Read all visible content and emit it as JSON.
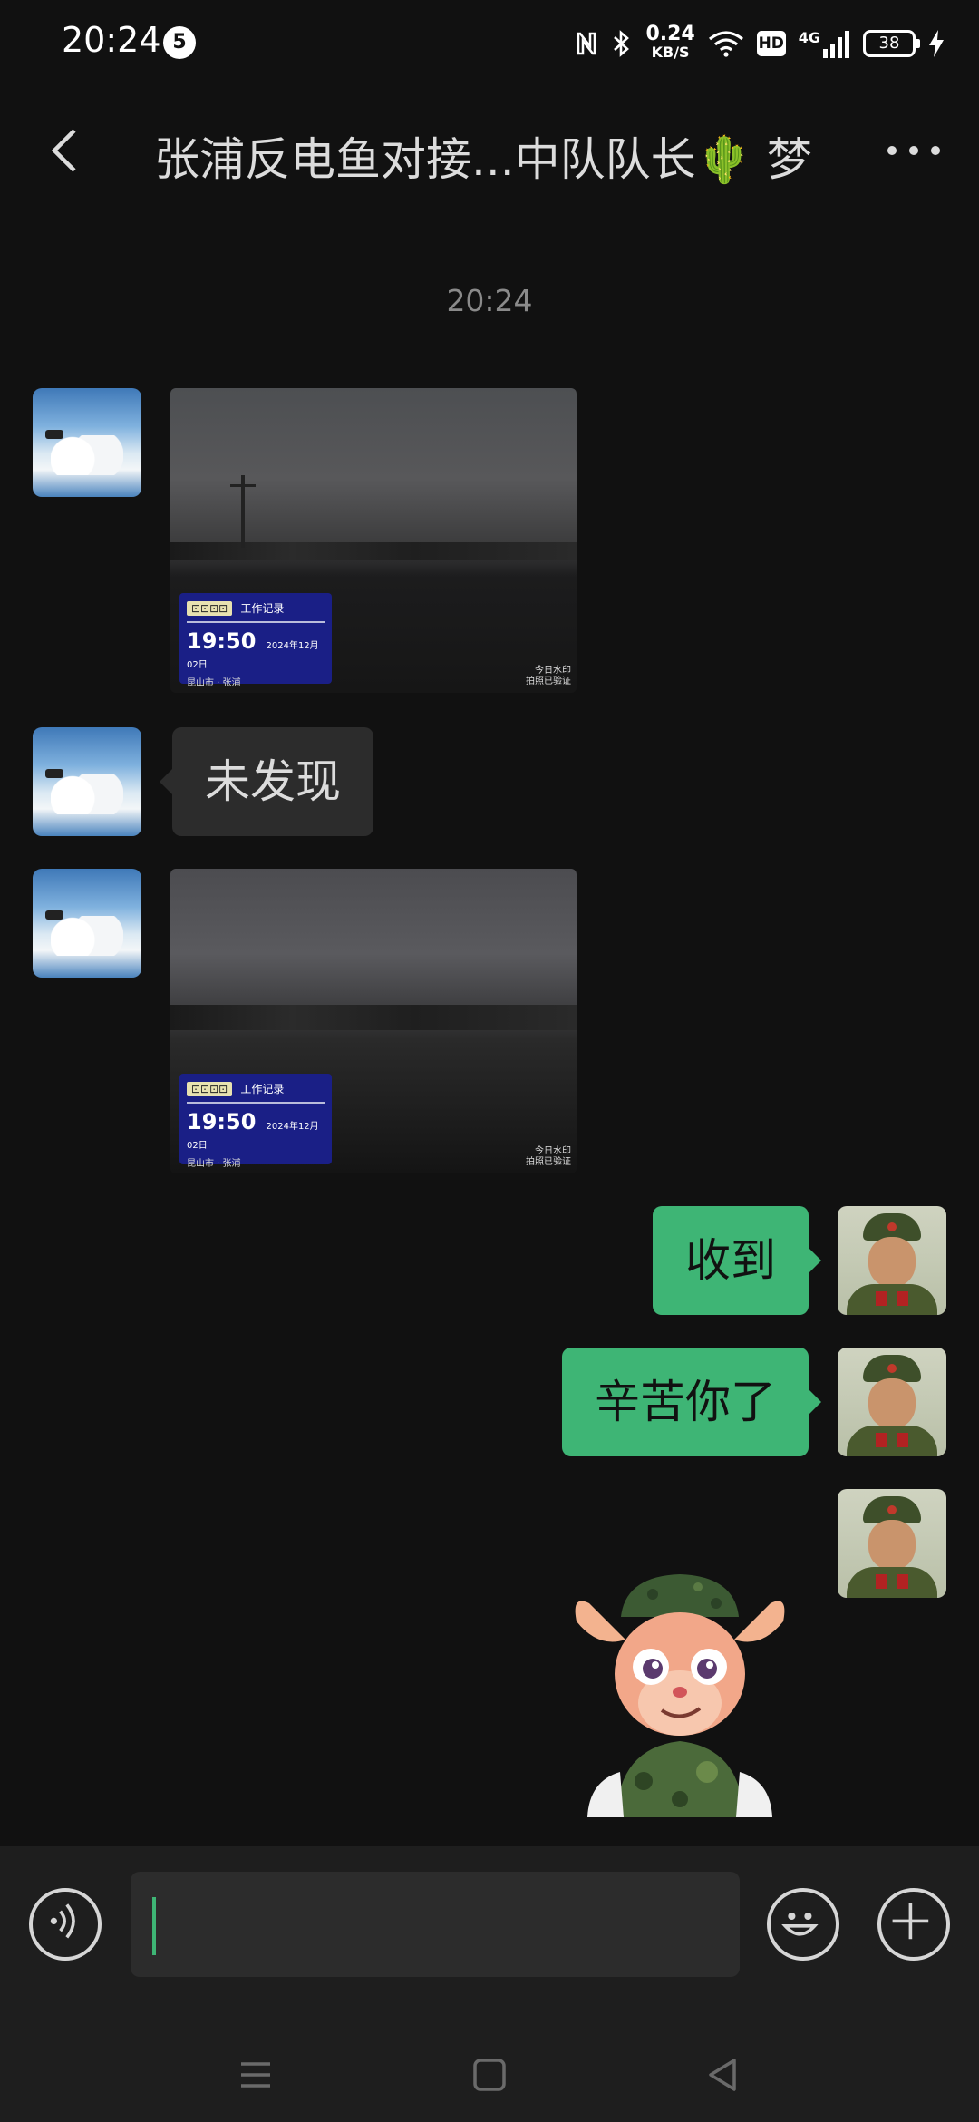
{
  "status_bar": {
    "time": "20:24",
    "notification_count": "5",
    "speed_value": "0.24",
    "speed_unit": "KB/S",
    "hd": "HD",
    "network": "4G",
    "battery": "38"
  },
  "header": {
    "title": "张浦反电鱼对接...中队队长🌵 梦",
    "icons": [
      "back-arrow-icon",
      "more-dots-icon"
    ]
  },
  "chat": {
    "timestamp": "20:24",
    "messages": [
      {
        "side": "in",
        "type": "image",
        "overlay": {
          "tag": "⊡⊡⊡⊡",
          "label": "工作记录",
          "time": "19:50",
          "date": "2024年12月02日",
          "sub": "昆山市 · 张浦",
          "watermark_1": "今日水印",
          "watermark_2": "拍照已验证"
        }
      },
      {
        "side": "in",
        "type": "text",
        "text": "未发现"
      },
      {
        "side": "in",
        "type": "image",
        "overlay": {
          "tag": "⊡⊡⊡⊡",
          "label": "工作记录",
          "time": "19:50",
          "date": "2024年12月02日",
          "sub": "昆山市 · 张浦",
          "watermark_1": "今日水印",
          "watermark_2": "拍照已验证"
        }
      },
      {
        "side": "out",
        "type": "text",
        "text": "收到"
      },
      {
        "side": "out",
        "type": "text",
        "text": "辛苦你了"
      },
      {
        "side": "out",
        "type": "sticker",
        "sticker": "cartoon-deer-soldier"
      }
    ]
  },
  "input_bar": {
    "value": "",
    "placeholder": "",
    "icons": [
      "voice-icon",
      "emoji-icon",
      "plus-icon"
    ]
  },
  "nav_bar": {
    "icons": [
      "menu-icon",
      "home-icon",
      "back-icon"
    ]
  },
  "colors": {
    "background": "#111111",
    "outgoing_bubble": "#3eb575",
    "incoming_bubble": "#2c2c2c",
    "input_bar": "#1e1e1e"
  }
}
